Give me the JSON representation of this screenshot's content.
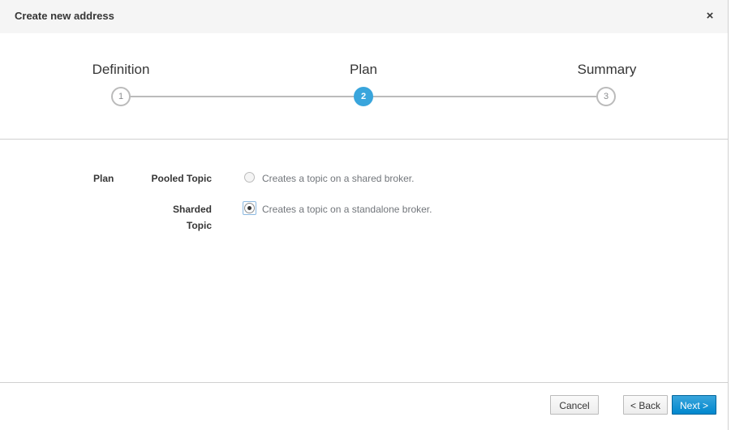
{
  "dialog": {
    "title": "Create new address",
    "close_symbol": "×"
  },
  "wizard": {
    "steps": [
      {
        "label": "Definition",
        "number": "1",
        "active": false
      },
      {
        "label": "Plan",
        "number": "2",
        "active": true
      },
      {
        "label": "Summary",
        "number": "3",
        "active": false
      }
    ]
  },
  "plan": {
    "field_label": "Plan",
    "options": [
      {
        "label": "Pooled Topic",
        "description": "Creates a topic on a shared broker.",
        "selected": false
      },
      {
        "label_line1": "Sharded",
        "label_line2": "Topic",
        "description": "Creates a topic on a standalone broker.",
        "selected": true
      }
    ]
  },
  "footer": {
    "cancel_label": "Cancel",
    "back_label": "< Back",
    "next_label": "Next >"
  },
  "colors": {
    "accent": "#39a5dc",
    "primary_button": "#0088ce"
  }
}
